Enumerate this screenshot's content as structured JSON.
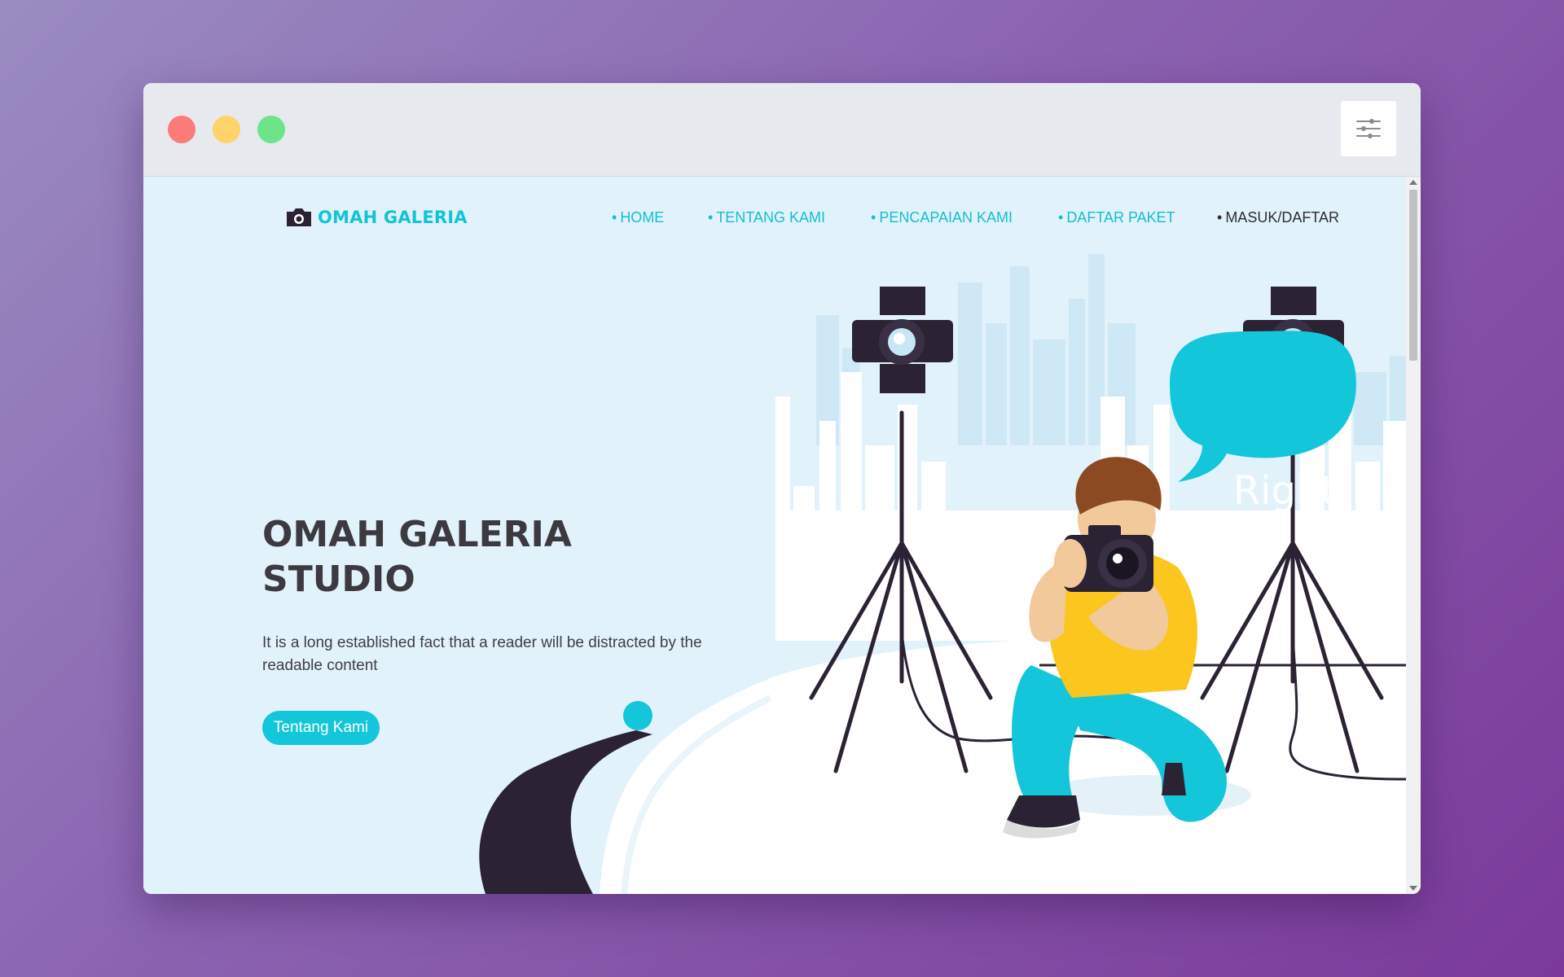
{
  "window": {
    "controls": [
      "close",
      "minimize",
      "maximize"
    ],
    "menu_icon": "sliders-icon"
  },
  "brand": {
    "name": "OMAH GALERIA",
    "icon": "camera-icon"
  },
  "nav": {
    "items": [
      {
        "label": "HOME"
      },
      {
        "label": "TENTANG KAMI"
      },
      {
        "label": "PENCAPAIAN KAMI"
      },
      {
        "label": "DAFTAR PAKET"
      },
      {
        "label": "MASUK/DAFTAR"
      }
    ]
  },
  "hero": {
    "title_line1": "OMAH GALERIA",
    "title_line2": "STUDIO",
    "description": "It is a long established fact that a reader will be distracted by the readable content",
    "button_label": "Tentang Kami"
  },
  "illustration": {
    "speech_bubble": "Right"
  },
  "colors": {
    "accent": "#12c4d8",
    "dark": "#2e2c35",
    "background": "#e2f2fb",
    "shirt": "#fbc61d"
  }
}
